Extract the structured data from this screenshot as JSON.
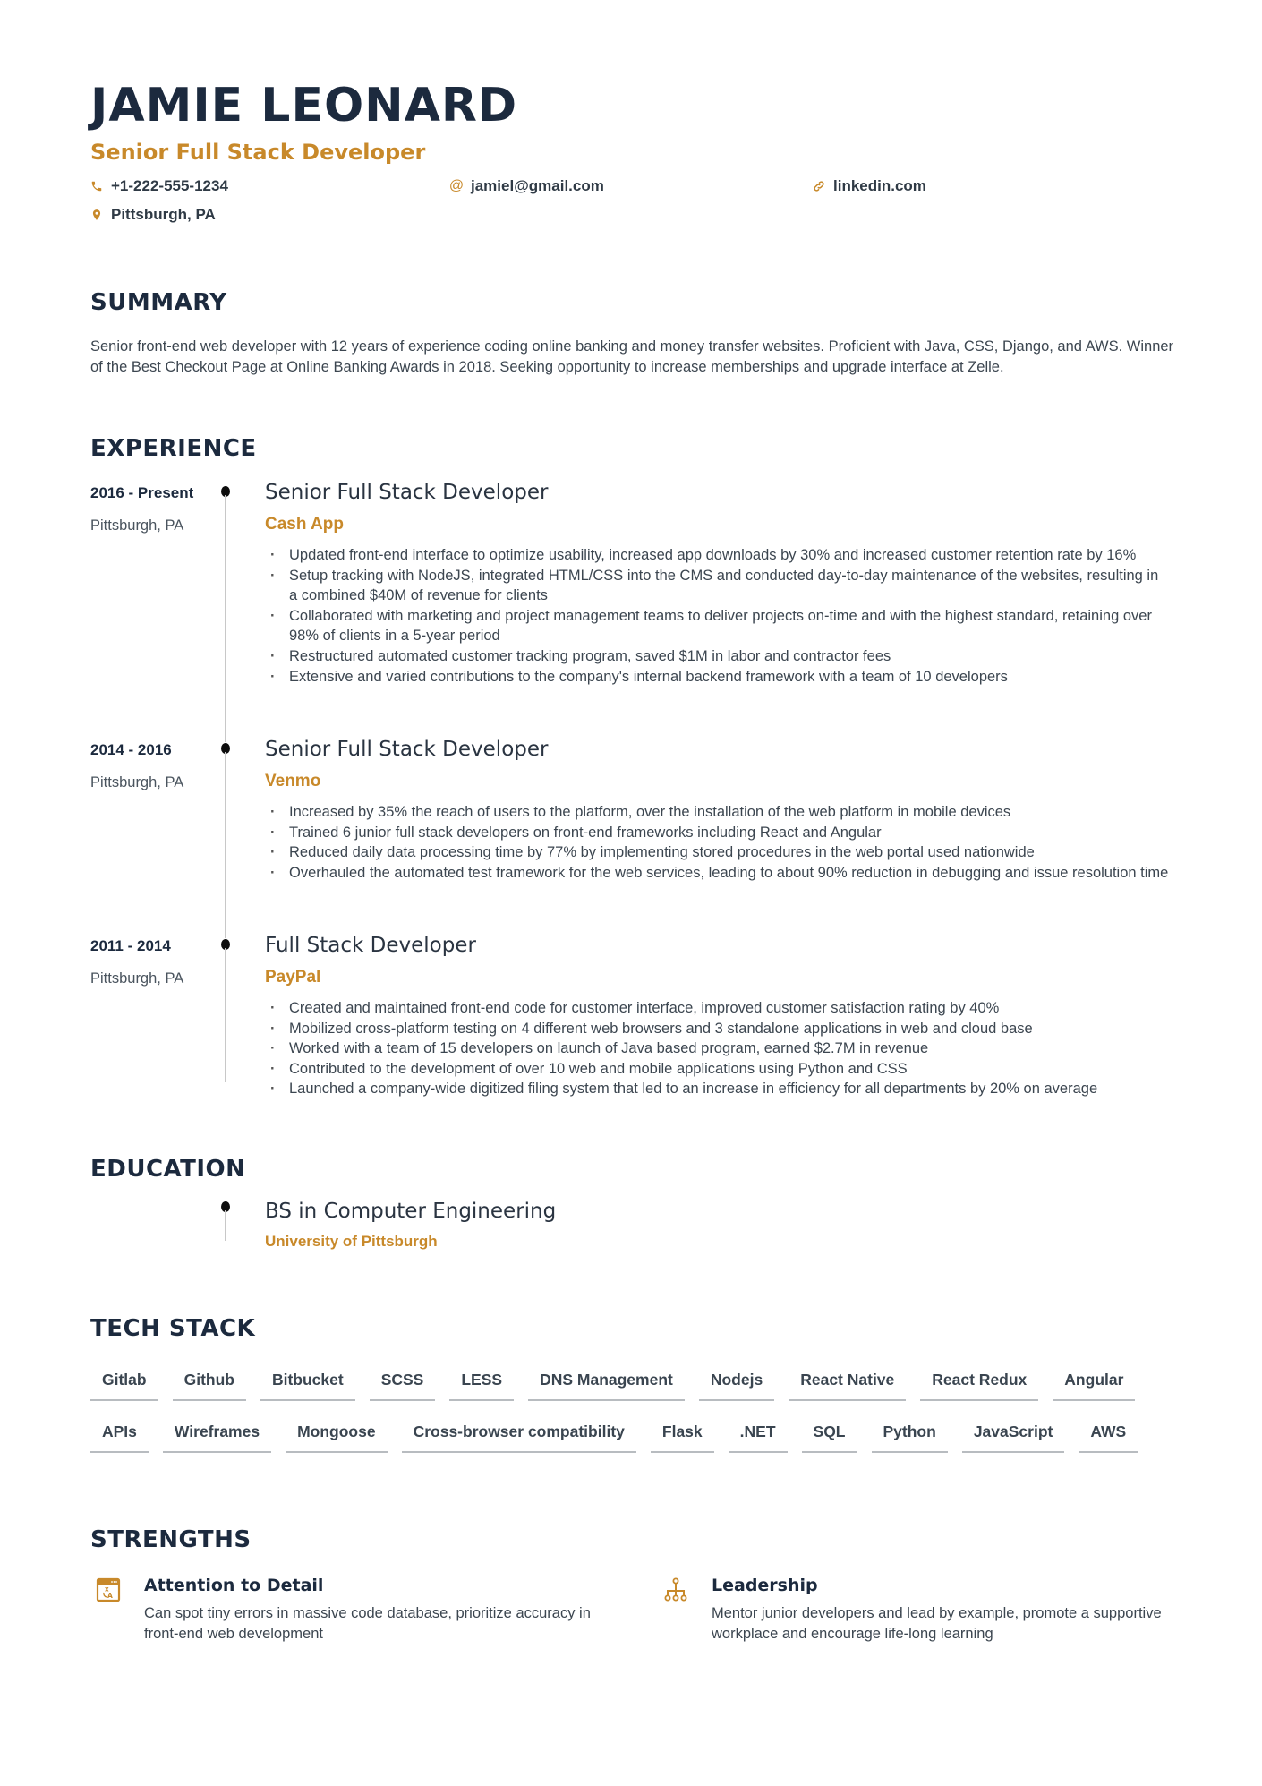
{
  "header": {
    "name": "JAMIE LEONARD",
    "title": "Senior Full Stack Developer",
    "contacts": [
      {
        "icon": "phone-icon",
        "text": "+1-222-555-1234"
      },
      {
        "icon": "at-sign-icon",
        "text": "jamiel@gmail.com"
      },
      {
        "icon": "link-icon",
        "text": "linkedin.com"
      },
      {
        "icon": "location-pin-icon",
        "text": "Pittsburgh, PA"
      }
    ]
  },
  "colors": {
    "accent": "#c8892a",
    "heading": "#1c2a3e",
    "body": "#3c4650",
    "timeline": "#c8c8c8"
  },
  "summary": {
    "heading": "SUMMARY",
    "text": "Senior front-end web developer with 12 years of experience coding online banking and money transfer websites. Proficient with Java, CSS, Django, and AWS. Winner of the Best Checkout Page at Online Banking Awards in 2018. Seeking opportunity to increase memberships and upgrade interface at Zelle."
  },
  "experience": {
    "heading": "EXPERIENCE",
    "jobs": [
      {
        "dates": "2016 - Present",
        "location": "Pittsburgh, PA",
        "role": "Senior Full Stack Developer",
        "company": "Cash App",
        "bullets": [
          "Updated front-end interface to optimize usability, increased app downloads by 30% and increased customer retention rate by 16%",
          "Setup tracking with NodeJS, integrated HTML/CSS into the CMS and conducted day-to-day maintenance of the websites, resulting in a combined $40M of revenue for clients",
          "Collaborated with marketing and project management teams to deliver projects on-time and with the highest standard, retaining over 98% of clients in a 5-year period",
          "Restructured automated customer tracking program, saved $1M in labor and contractor fees",
          "Extensive and varied contributions to the company's internal backend framework with a team of 10 developers"
        ]
      },
      {
        "dates": "2014 - 2016",
        "location": "Pittsburgh, PA",
        "role": "Senior Full Stack Developer",
        "company": "Venmo",
        "bullets": [
          "Increased by 35% the reach of users to the platform, over the installation of the web platform in mobile devices",
          "Trained 6 junior full stack developers on front-end frameworks including React and Angular",
          "Reduced daily data processing time by 77% by implementing stored procedures in the web portal used nationwide",
          "Overhauled the automated test framework for the web services, leading to about 90% reduction in debugging and issue resolution time"
        ]
      },
      {
        "dates": "2011 - 2014",
        "location": "Pittsburgh, PA",
        "role": "Full Stack Developer",
        "company": "PayPal",
        "bullets": [
          "Created and maintained front-end code for customer interface, improved customer satisfaction rating by 40%",
          "Mobilized cross-platform testing on 4 different web browsers and 3 standalone applications in web and cloud base",
          "Worked with a team of 15 developers on launch of Java based program, earned $2.7M in revenue",
          "Contributed to the development of over 10 web and mobile applications using Python and CSS",
          "Launched a company-wide digitized filing system that led to an increase in efficiency for all departments by 20% on average"
        ]
      }
    ]
  },
  "education": {
    "heading": "EDUCATION",
    "degree": "BS in Computer Engineering",
    "school": "University of Pittsburgh"
  },
  "tech_stack": {
    "heading": "TECH STACK",
    "rows": [
      [
        "Gitlab",
        "Github",
        "Bitbucket",
        "SCSS",
        "LESS",
        "DNS Management",
        "Nodejs",
        "React Native",
        "React Redux",
        "Angular"
      ],
      [
        "APIs",
        "Wireframes",
        "Mongoose",
        "Cross-browser compatibility",
        "Flask",
        ".NET",
        "SQL",
        "Python",
        "JavaScript",
        "AWS"
      ]
    ]
  },
  "strengths": {
    "heading": "STRENGTHS",
    "items": [
      {
        "icon": "translate-window-icon",
        "title": "Attention to Detail",
        "description": "Can spot tiny errors in massive code database, prioritize accuracy in front-end web development"
      },
      {
        "icon": "hierarchy-icon",
        "title": "Leadership",
        "description": "Mentor junior developers and lead by example, promote a supportive workplace and encourage life-long learning"
      }
    ]
  }
}
